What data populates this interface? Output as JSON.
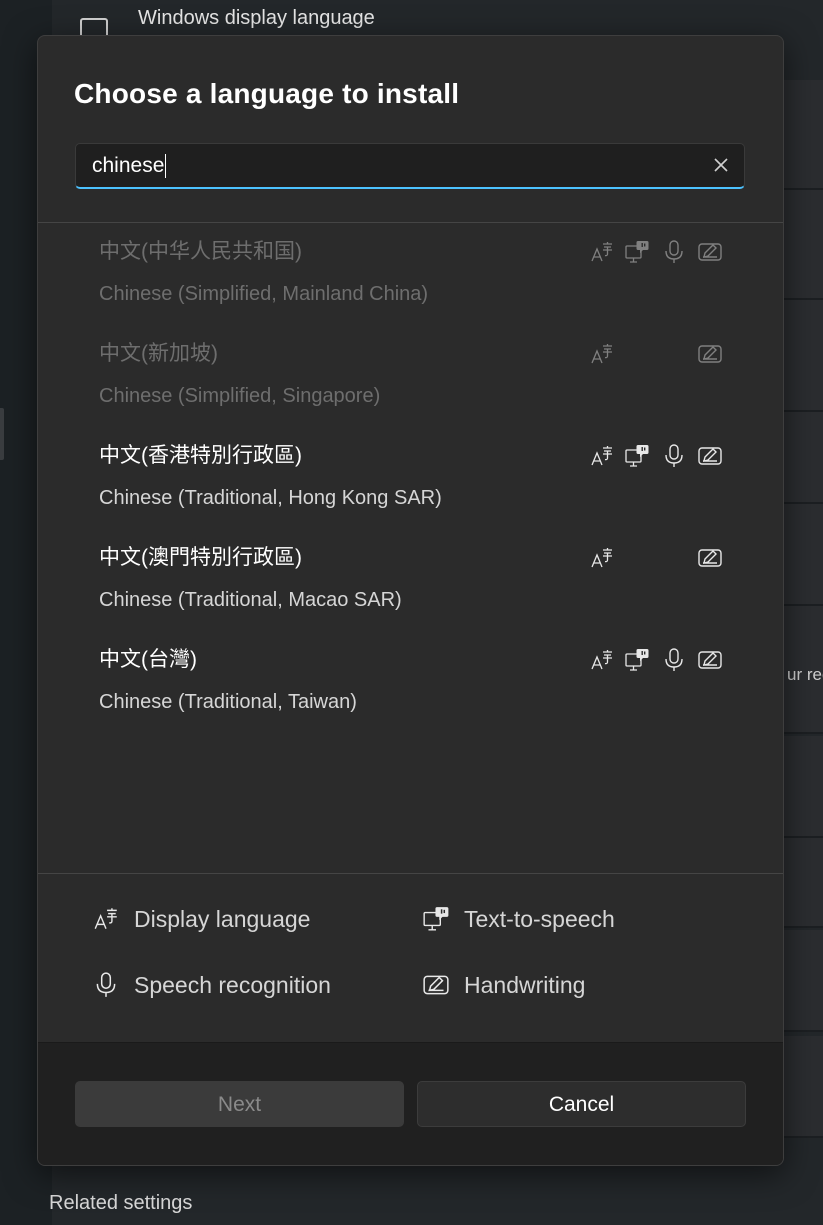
{
  "background": {
    "top_item_label": "Windows display language",
    "right_clipped_text": "ur reg",
    "related_settings_label": "Related settings"
  },
  "dialog": {
    "title": "Choose a language to install",
    "search": {
      "value": "chinese"
    },
    "languages": [
      {
        "native": "中文(中华人民共和国)",
        "english": "Chinese (Simplified, Mainland China)",
        "state": "disabled",
        "features": [
          "display-language",
          "text-to-speech",
          "speech-recognition",
          "handwriting"
        ]
      },
      {
        "native": "中文(新加坡)",
        "english": "Chinese (Simplified, Singapore)",
        "state": "disabled",
        "features": [
          "display-language",
          "handwriting"
        ]
      },
      {
        "native": "中文(香港特別行政區)",
        "english": "Chinese (Traditional, Hong Kong SAR)",
        "state": "enabled",
        "features": [
          "display-language",
          "text-to-speech",
          "speech-recognition",
          "handwriting"
        ]
      },
      {
        "native": "中文(澳門特別行政區)",
        "english": "Chinese (Traditional, Macao SAR)",
        "state": "enabled",
        "features": [
          "display-language",
          "handwriting"
        ]
      },
      {
        "native": "中文(台灣)",
        "english": "Chinese (Traditional, Taiwan)",
        "state": "enabled",
        "features": [
          "display-language",
          "text-to-speech",
          "speech-recognition",
          "handwriting"
        ]
      }
    ],
    "legend": {
      "display_language": "Display language",
      "text_to_speech": "Text-to-speech",
      "speech_recognition": "Speech recognition",
      "handwriting": "Handwriting"
    },
    "buttons": {
      "next": "Next",
      "cancel": "Cancel"
    }
  },
  "colors": {
    "accent": "#4cc2ff",
    "dialog_bg": "#2b2b2b",
    "footer_bg": "#202020"
  }
}
